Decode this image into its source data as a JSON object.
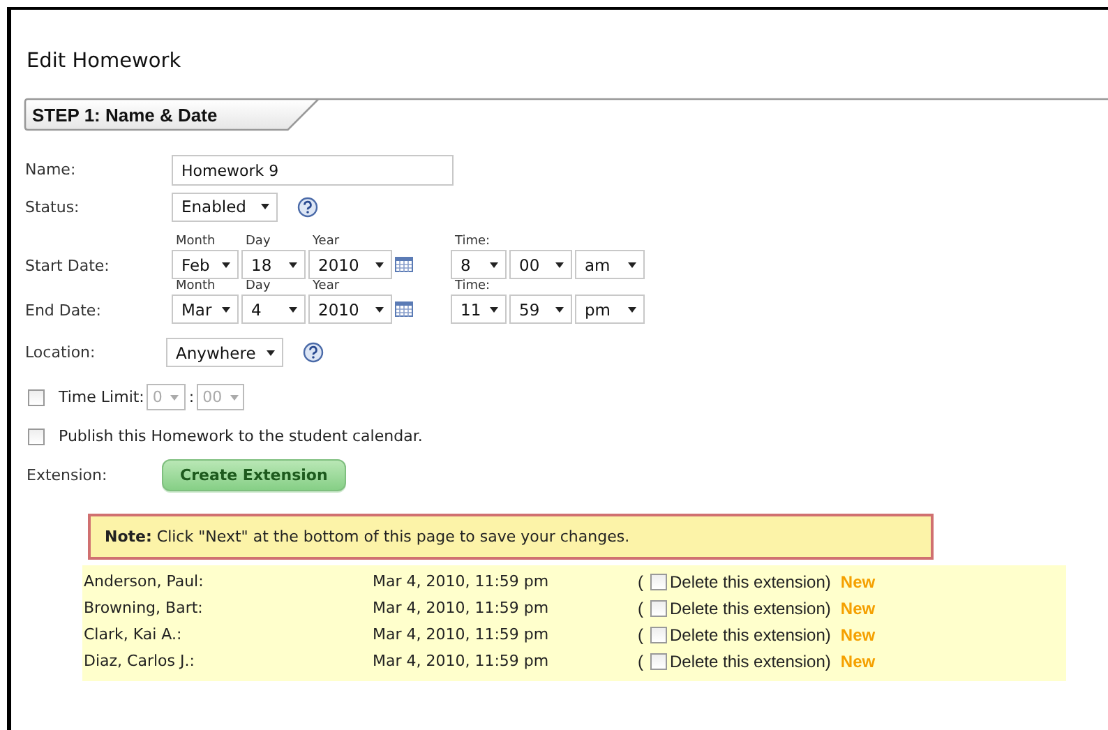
{
  "page": {
    "title": "Edit Homework"
  },
  "section": {
    "title": "STEP 1: Name & Date"
  },
  "name": {
    "label": "Name:",
    "value": "Homework 9"
  },
  "status": {
    "label": "Status:",
    "value": "Enabled"
  },
  "dates": [
    {
      "label": "Start Date:",
      "month_label": "Month",
      "month": "Feb",
      "day_label": "Day",
      "day": "18",
      "year_label": "Year",
      "year": "2010",
      "time_label": "Time:",
      "hour": "8",
      "minute": "00",
      "ampm": "am"
    },
    {
      "label": "End Date:",
      "month_label": "Month",
      "month": "Mar",
      "day_label": "Day",
      "day": "4",
      "year_label": "Year",
      "year": "2010",
      "time_label": "Time:",
      "hour": "11",
      "minute": "59",
      "ampm": "pm"
    }
  ],
  "location": {
    "label": "Location:",
    "value": "Anywhere"
  },
  "time_limit": {
    "label": "Time Limit:",
    "checked": false,
    "hours": "0",
    "separator": ":",
    "minutes": "00",
    "disabled": true
  },
  "publish": {
    "label": "Publish this Homework to the student calendar.",
    "checked": false
  },
  "extension": {
    "label": "Extension:",
    "button": "Create Extension"
  },
  "note": {
    "text": "**Note:** Click \"Next\" at the bottom of this page to save your changes."
  },
  "extensions": [
    {
      "student": "Anderson, Paul:",
      "due": "Mar 4, 2010, 11:59 pm",
      "open_paren": "(",
      "delete_label": "Delete this extension)",
      "checked": false,
      "badge": "New"
    },
    {
      "student": "Browning, Bart:",
      "due": "Mar 4, 2010, 11:59 pm",
      "open_paren": "(",
      "delete_label": "Delete this extension)",
      "checked": false,
      "badge": "New"
    },
    {
      "student": "Clark, Kai A.:",
      "due": "Mar 4, 2010, 11:59 pm",
      "open_paren": "(",
      "delete_label": "Delete this extension)",
      "checked": false,
      "badge": "New"
    },
    {
      "student": "Diaz, Carlos J.:",
      "due": "Mar 4, 2010, 11:59 pm",
      "open_paren": "(",
      "delete_label": "Delete this extension)",
      "checked": false,
      "badge": "New"
    }
  ]
}
